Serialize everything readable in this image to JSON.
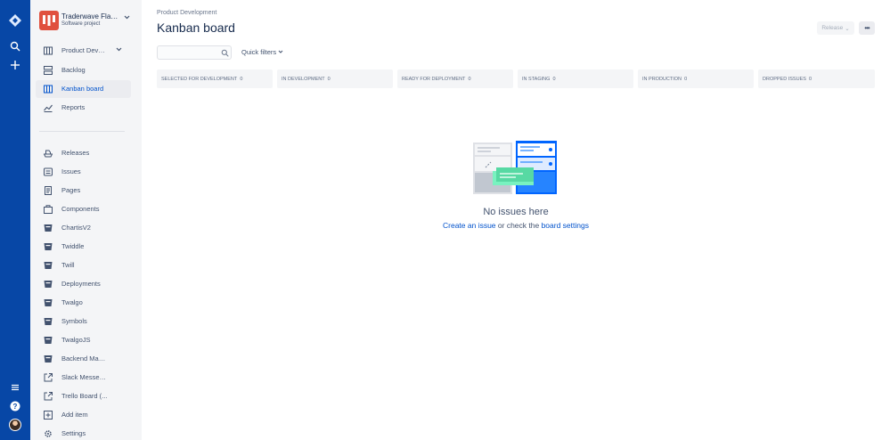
{
  "project": {
    "name": "Traderwave Flags...",
    "type": "Software project"
  },
  "sidebar": {
    "top_items": [
      {
        "label": "Product Devel...",
        "icon": "board-icon"
      },
      {
        "label": "Backlog",
        "icon": "backlog-icon"
      },
      {
        "label": "Kanban board",
        "icon": "kanban-icon"
      },
      {
        "label": "Reports",
        "icon": "reports-icon"
      }
    ],
    "items": [
      {
        "label": "Releases",
        "icon": "ship-icon"
      },
      {
        "label": "Issues",
        "icon": "issues-icon"
      },
      {
        "label": "Pages",
        "icon": "page-icon"
      },
      {
        "label": "Components",
        "icon": "component-icon"
      },
      {
        "label": "ChartisV2",
        "icon": "repo-icon"
      },
      {
        "label": "Twiddle",
        "icon": "repo-icon"
      },
      {
        "label": "Twill",
        "icon": "repo-icon"
      },
      {
        "label": "Deployments",
        "icon": "repo-icon"
      },
      {
        "label": "Twalgo",
        "icon": "repo-icon"
      },
      {
        "label": "Symbols",
        "icon": "repo-icon"
      },
      {
        "label": "TwalgoJS",
        "icon": "repo-icon"
      },
      {
        "label": "Backend Man...",
        "icon": "repo-icon"
      },
      {
        "label": "Slack Messen...",
        "icon": "external-link-icon"
      },
      {
        "label": "Trello Board (...",
        "icon": "external-link-icon"
      },
      {
        "label": "Add item",
        "icon": "add-icon"
      },
      {
        "label": "Settings",
        "icon": "settings-icon"
      }
    ]
  },
  "header": {
    "breadcrumb": "Product Development",
    "title": "Kanban board",
    "release_label": "Release",
    "release_chevron": "⌄",
    "more_label": "•••"
  },
  "toolbar": {
    "search_value": "",
    "search_placeholder": "",
    "quick_filters_label": "Quick filters"
  },
  "columns": [
    {
      "label": "SELECTED FOR DEVELOPMENT",
      "count": "0"
    },
    {
      "label": "IN DEVELOPMENT",
      "count": "0"
    },
    {
      "label": "READY FOR DEPLOYMENT",
      "count": "0"
    },
    {
      "label": "IN STAGING",
      "count": "0"
    },
    {
      "label": "IN PRODUCTION",
      "count": "0"
    },
    {
      "label": "DROPPED ISSUES",
      "count": "0"
    }
  ],
  "empty_state": {
    "title": "No issues here",
    "create_link": "Create an issue",
    "middle_text": " or check the ",
    "settings_link": "board settings"
  },
  "colors": {
    "global_nav": "#0747A6",
    "sidebar_bg": "#F4F5F7",
    "accent": "#0052CC",
    "project_avatar": "#E0503E"
  }
}
